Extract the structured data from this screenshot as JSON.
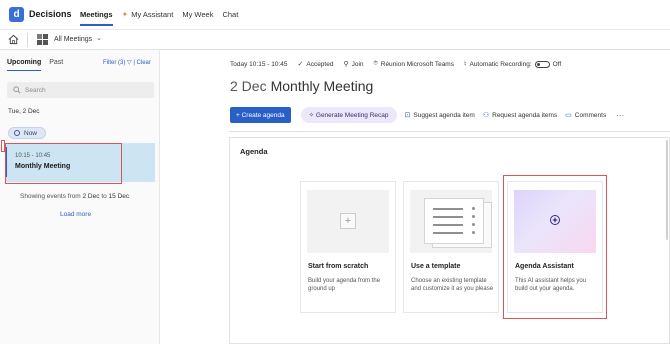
{
  "topbar": {
    "logo_letter": "d",
    "app_title": "Decisions",
    "nav": [
      {
        "label": "Meetings",
        "active": true
      },
      {
        "label": "My Assistant",
        "active": false,
        "icon": "sparkle-icon"
      },
      {
        "label": "My Week",
        "active": false
      },
      {
        "label": "Chat",
        "active": false
      }
    ]
  },
  "subbar": {
    "view_label": "All Meetings"
  },
  "left": {
    "tabs": [
      "Upcoming",
      "Past"
    ],
    "filter_label": "Filter (3)",
    "clear_label": "Clear",
    "search_placeholder": "Search",
    "day_label": "Tue, 2 Dec",
    "now_label": "Now",
    "event": {
      "time": "10:15 - 10:45",
      "name": "Monthly Meeting"
    },
    "showing_prefix": "Showing events from",
    "showing_from": "2 Dec",
    "showing_to_word": "to",
    "showing_to": "15 Dec",
    "load_more": "Load more"
  },
  "meeting": {
    "day": "Today",
    "time": "10:15 - 10:45",
    "status": "Accepted",
    "join": "Join",
    "location": "Réunion Microsoft Teams",
    "recording_label": "Automatic Recording:",
    "recording_state": "Off",
    "title_date": "2 Dec",
    "title_name": "Monthly Meeting"
  },
  "actions": {
    "create_agenda": "Create agenda",
    "generate_recap": "Generate Meeting Recap",
    "suggest_item": "Suggest agenda item",
    "request_items": "Request agenda items",
    "comments": "Comments"
  },
  "agenda": {
    "section_title": "Agenda",
    "options": [
      {
        "title": "Start from scratch",
        "desc": "Build your agenda from the ground up"
      },
      {
        "title": "Use a template",
        "desc": "Choose an existing template and customize it as you please"
      },
      {
        "title": "Agenda Assistant",
        "desc": "This AI assistant helps you build out your agenda."
      }
    ]
  },
  "colors": {
    "accent": "#2b5fc8",
    "highlight_box": "#d9555a",
    "event_bg": "#cde4f3",
    "ai_pill": "#ece7fb"
  }
}
